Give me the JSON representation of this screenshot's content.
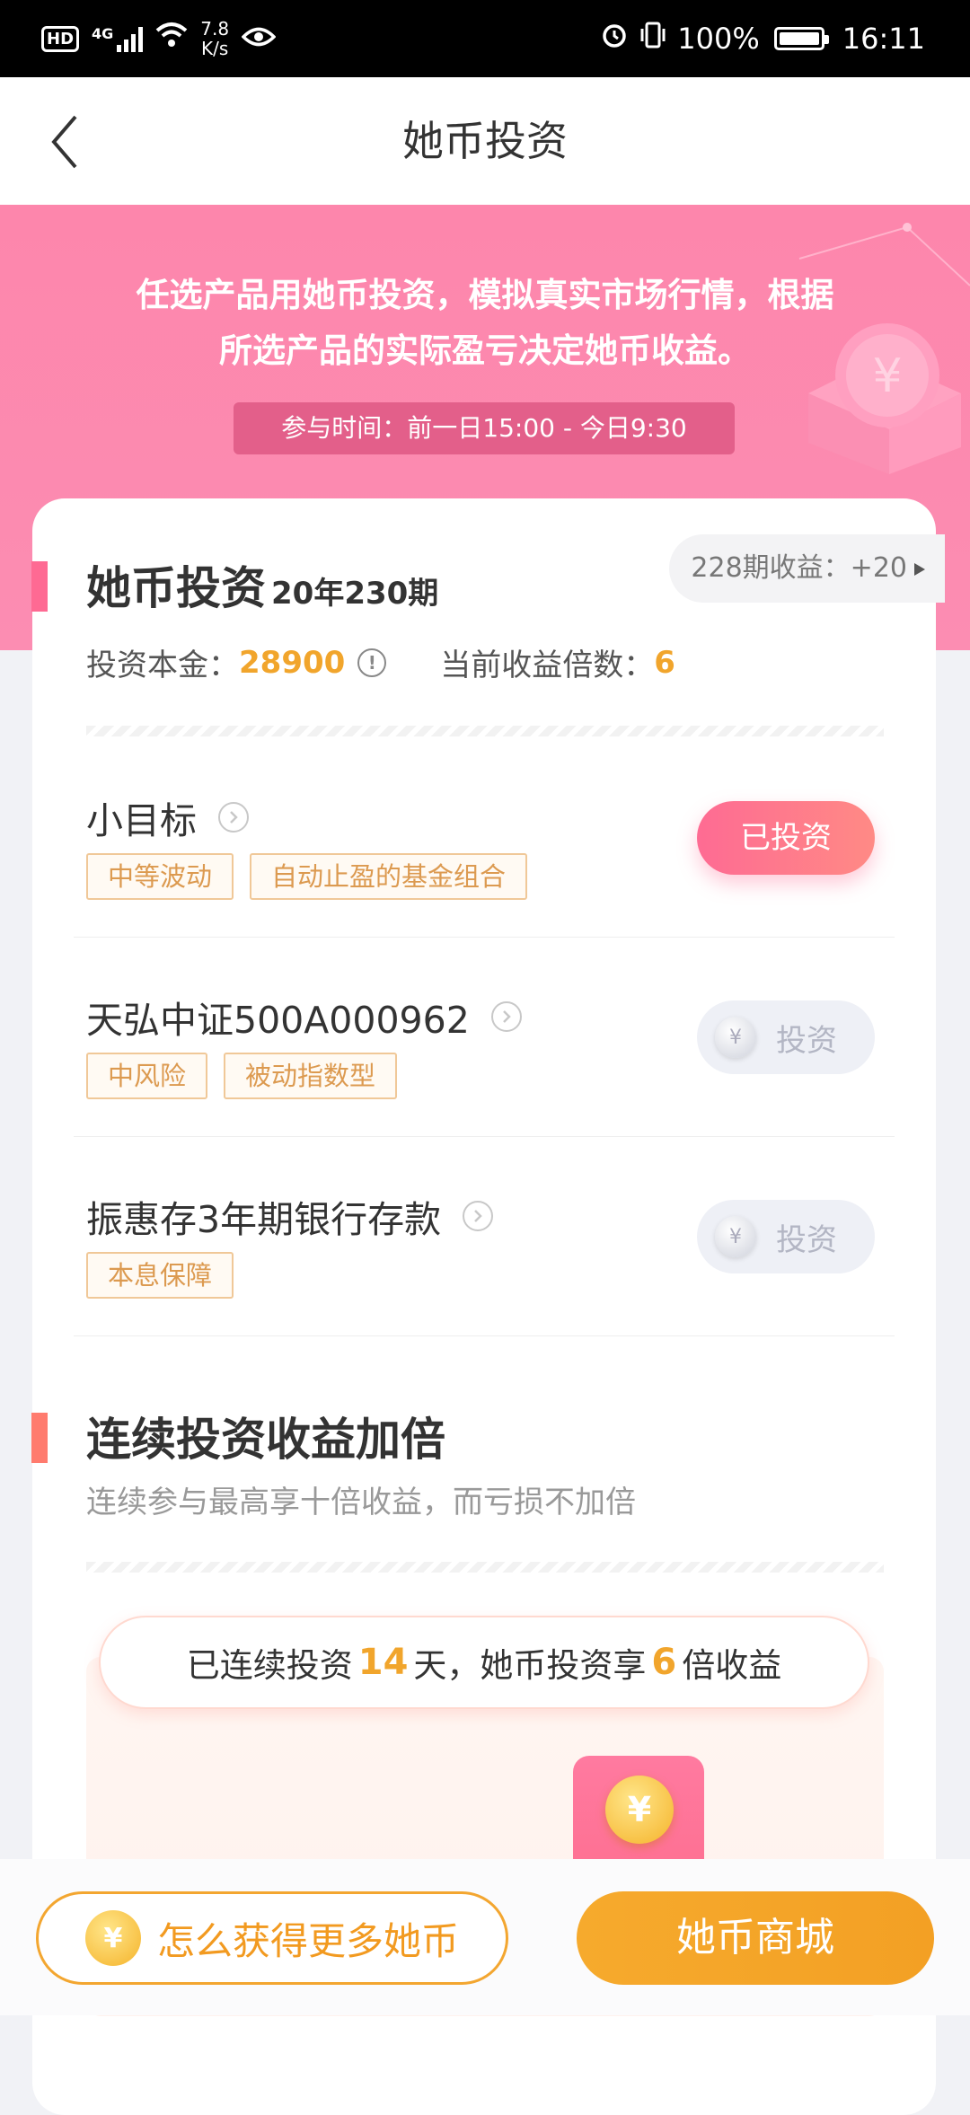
{
  "status_bar": {
    "hd": "HD",
    "network": "4G",
    "speed_value": "7.8",
    "speed_unit": "K/s",
    "battery": "100%",
    "time": "16:11"
  },
  "nav": {
    "title": "她币投资"
  },
  "banner": {
    "line1": "任选产品用她币投资，模拟真实市场行情，根据",
    "line2": "所选产品的实际盈亏决定她币收益。",
    "time": "参与时间：前一日15:00 - 今日9:30"
  },
  "investment": {
    "title": "她币投资",
    "period": "20年230期",
    "prev_earning": "228期收益：+20",
    "principal_label": "投资本金：",
    "principal_value": "28900",
    "multiplier_label": "当前收益倍数：",
    "multiplier_value": "6"
  },
  "products": [
    {
      "name": "小目标",
      "tags": [
        "中等波动",
        "自动止盈的基金组合"
      ],
      "button": "已投资"
    },
    {
      "name": "天弘中证500A000962",
      "tags": [
        "中风险",
        "被动指数型"
      ],
      "button": "投资"
    },
    {
      "name": "振惠存3年期银行存款",
      "tags": [
        "本息保障"
      ],
      "button": "投资"
    }
  ],
  "bonus": {
    "title": "连续投资收益加倍",
    "desc": "连续参与最高享十倍收益，而亏损不加倍",
    "text_pre": "已连续投资",
    "days": "14",
    "text_mid": "天，她币投资享",
    "times": "6",
    "text_post": "倍收益"
  },
  "bottom": {
    "how_label": "怎么获得更多她币",
    "mall_label": "她币商城"
  },
  "icons": {
    "coin": "¥"
  },
  "colors": {
    "accent_pink": "#fd86ac",
    "accent_orange": "#f3a630",
    "number_orange": "#f1a52c"
  }
}
